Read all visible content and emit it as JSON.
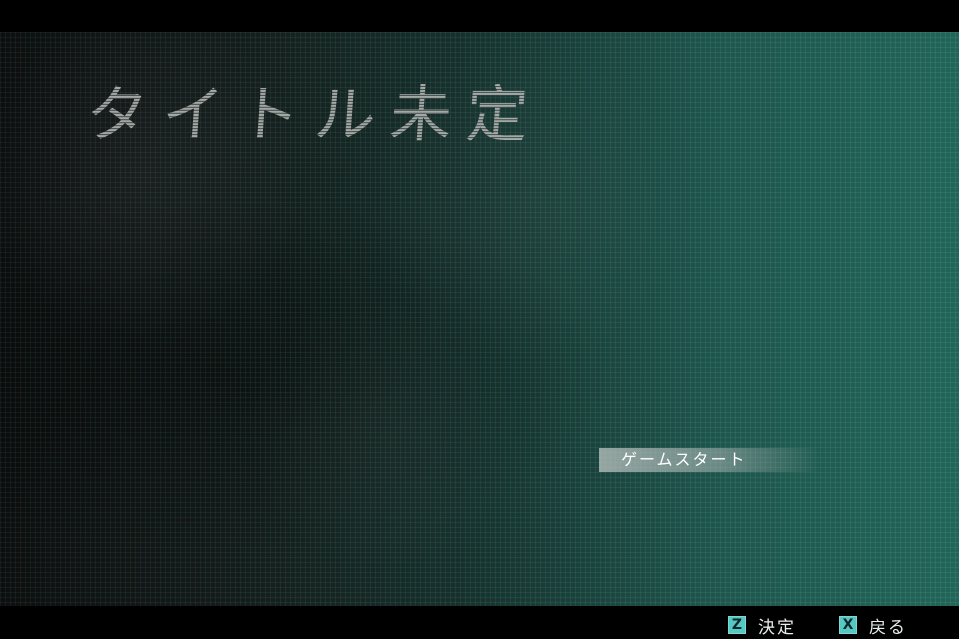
{
  "title": "タイトル未定",
  "menu": {
    "items": [
      {
        "label": "ゲームスタート",
        "selected": true
      }
    ]
  },
  "controls": {
    "confirm": {
      "key": "Z",
      "label": "決定"
    },
    "back": {
      "key": "X",
      "label": "戻る"
    }
  },
  "colors": {
    "background_left": "#0d0f0f",
    "background_right": "#226458",
    "key_icon": "#56c8c4",
    "menu_highlight": "#bec6c4"
  }
}
